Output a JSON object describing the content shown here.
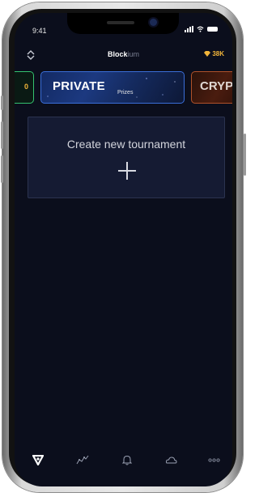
{
  "status_bar": {
    "time": "9:41"
  },
  "header": {
    "title_bold": "Block",
    "title_light": "ium",
    "balance": "38K",
    "icons": {
      "switch": "switch-arrows-icon",
      "coin": "gem-coin-icon"
    }
  },
  "carousel": {
    "prev_partial_label": "0",
    "cards": [
      {
        "title": "PRIVATE",
        "subtitle": "Prizes"
      },
      {
        "title": "CRYP"
      }
    ]
  },
  "create_tournament": {
    "label": "Create new tournament",
    "icon": "plus-icon"
  },
  "tabbar": {
    "tabs": [
      {
        "icon": "home-logo-icon",
        "active": true
      },
      {
        "icon": "chart-line-icon",
        "active": false
      },
      {
        "icon": "bell-icon",
        "active": false
      },
      {
        "icon": "cloud-icon",
        "active": false
      },
      {
        "icon": "more-dots-icon",
        "active": false
      }
    ]
  },
  "colors": {
    "background": "#0b0e1c",
    "accent_gold": "#f2b53a",
    "card_blue_border": "#3a6ed8",
    "card_green_border": "#34c26f",
    "card_orange_border": "#b0522a"
  }
}
